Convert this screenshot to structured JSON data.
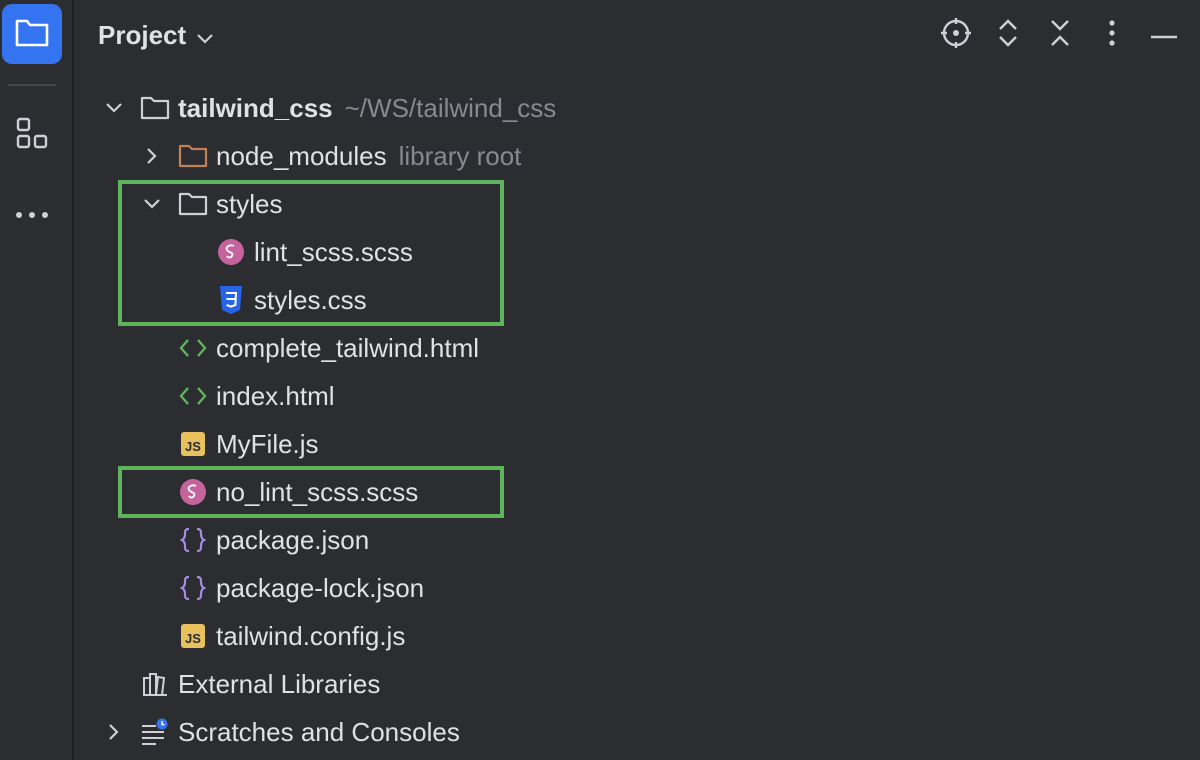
{
  "header": {
    "title": "Project"
  },
  "tree": {
    "root": {
      "name": "tailwind_css",
      "path": "~/WS/tailwind_css"
    },
    "node_modules": {
      "name": "node_modules",
      "hint": "library root"
    },
    "styles": {
      "name": "styles",
      "children": [
        "lint_scss.scss",
        "styles.css"
      ]
    },
    "files": [
      "complete_tailwind.html",
      "index.html",
      "MyFile.js",
      "no_lint_scss.scss",
      "package.json",
      "package-lock.json",
      "tailwind.config.js"
    ],
    "external": "External Libraries",
    "scratches": "Scratches and Consoles"
  },
  "colors": {
    "accent": "#3574F0",
    "highlight": "#5FB35A",
    "folder_brown": "#C0805A",
    "scss_pink": "#C5649C",
    "css_blue": "#2864E8",
    "html_green": "#5FB35A",
    "js_yellow": "#E8C15E",
    "json_purple": "#A98CE6"
  },
  "icons": {
    "rail": [
      "folder-icon",
      "structure-icon",
      "more-icon"
    ],
    "header": [
      "locate-icon",
      "expand-all-icon",
      "collapse-all-icon",
      "options-icon",
      "hide-icon"
    ]
  }
}
